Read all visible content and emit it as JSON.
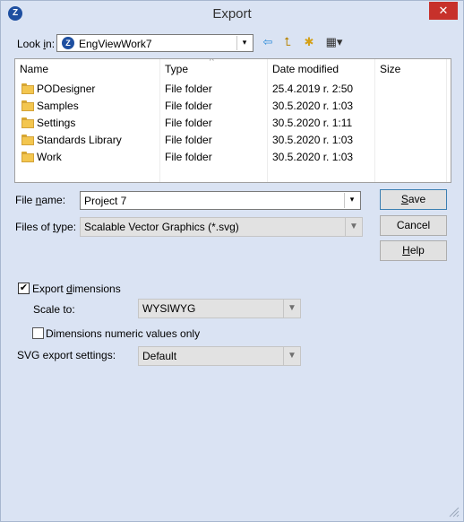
{
  "window": {
    "title": "Export",
    "close_glyph": "✕",
    "app_icon_letter": "Z"
  },
  "look_in": {
    "label_pre": "Look ",
    "label_key": "i",
    "label_post": "n:",
    "value": "EngViewWork7"
  },
  "toolbar": {
    "back_glyph": "⇦",
    "up_glyph": "⮤",
    "new_folder_glyph": "✱",
    "view_glyph": "▦▾"
  },
  "list": {
    "columns": [
      "Name",
      "Type",
      "Date modified",
      "Size"
    ],
    "sort_indicator": "^",
    "rows": [
      {
        "name": "PODesigner",
        "type": "File folder",
        "date": "25.4.2019 r. 2:50",
        "size": ""
      },
      {
        "name": "Samples",
        "type": "File folder",
        "date": "30.5.2020 r. 1:03",
        "size": ""
      },
      {
        "name": "Settings",
        "type": "File folder",
        "date": "30.5.2020 r. 1:11",
        "size": ""
      },
      {
        "name": "Standards Library",
        "type": "File folder",
        "date": "30.5.2020 r. 1:03",
        "size": ""
      },
      {
        "name": "Work",
        "type": "File folder",
        "date": "30.5.2020 r. 1:03",
        "size": ""
      }
    ]
  },
  "file_name": {
    "label_pre": "File ",
    "label_key": "n",
    "label_post": "ame:",
    "value": "Project 7"
  },
  "files_of_type": {
    "label_pre": "Files of ",
    "label_key": "t",
    "label_post": "ype:",
    "value": "Scalable Vector Graphics (*.svg)"
  },
  "buttons": {
    "save": {
      "key": "S",
      "rest": "ave"
    },
    "cancel": "Cancel",
    "help": {
      "key": "H",
      "rest": "elp"
    }
  },
  "export_dimensions": {
    "checked": "✔",
    "label_pre": "Export ",
    "label_key": "d",
    "label_post": "imensions"
  },
  "scale_to": {
    "label": "Scale to:",
    "value": "WYSIWYG"
  },
  "numeric_only": {
    "checked": "",
    "label": "Dimensions numeric values only"
  },
  "svg_settings": {
    "label": "SVG export settings:",
    "value": "Default"
  },
  "dropdown_glyph": "▼",
  "combo_glyph": "▾",
  "colors": {
    "background": "#dae3f3",
    "close": "#c7312b",
    "accent": "#1e4fa0"
  }
}
